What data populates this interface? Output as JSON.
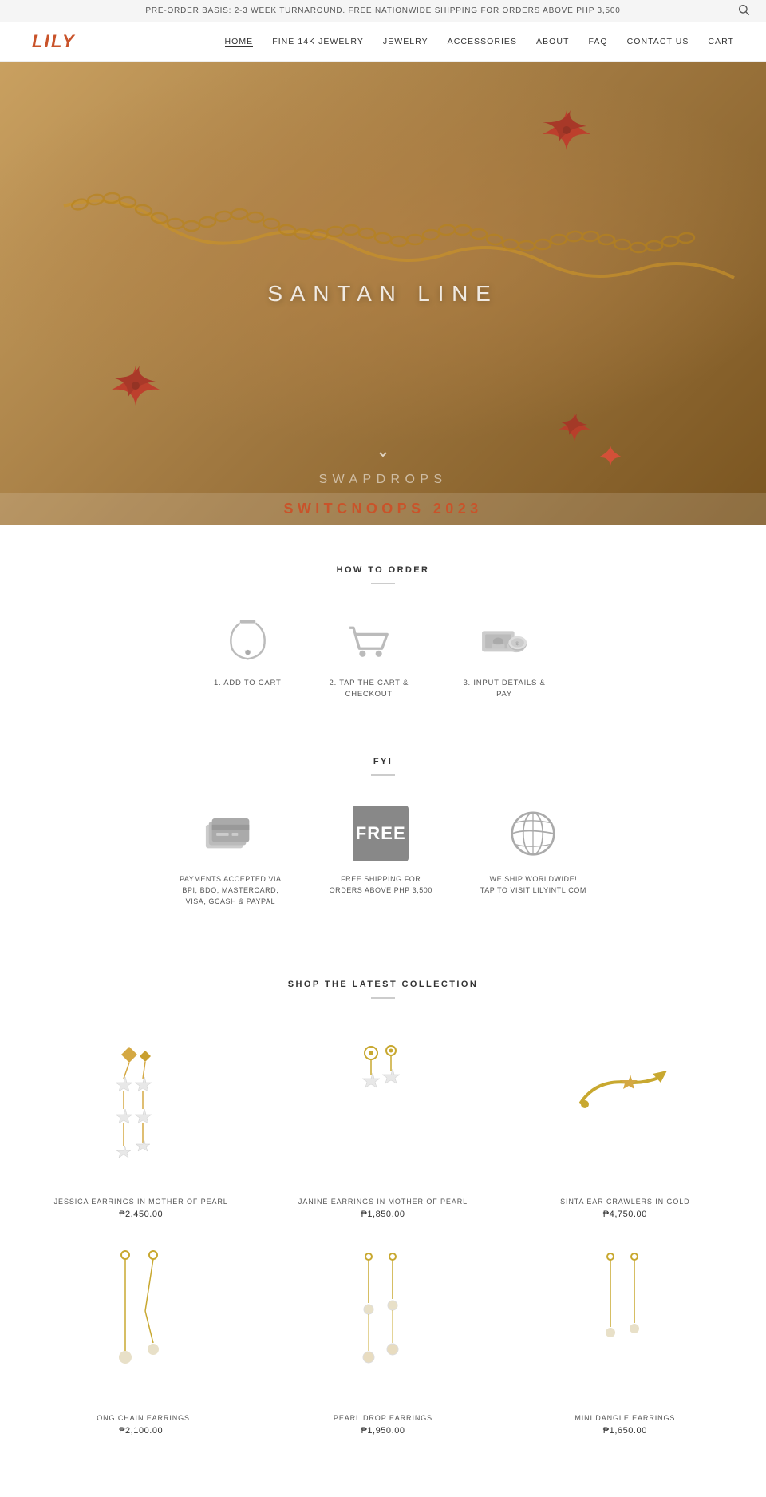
{
  "announcement": {
    "text": "PRE-ORDER BASIS: 2-3 WEEK TURNAROUND. FREE NATIONWIDE SHIPPING FOR ORDERS ABOVE PHP 3,500",
    "search_icon": "search-icon"
  },
  "header": {
    "logo": "LILY",
    "nav_items": [
      {
        "label": "HOME",
        "active": true,
        "key": "home"
      },
      {
        "label": "FINE 14K JEWELRY",
        "active": false,
        "key": "fine-14k"
      },
      {
        "label": "JEWELRY",
        "active": false,
        "key": "jewelry"
      },
      {
        "label": "ACCESSORIES",
        "active": false,
        "key": "accessories"
      },
      {
        "label": "ABOUT",
        "active": false,
        "key": "about"
      },
      {
        "label": "FAQ",
        "active": false,
        "key": "faq"
      },
      {
        "label": "CONTACT US",
        "active": false,
        "key": "contact"
      },
      {
        "label": "CART",
        "active": false,
        "key": "cart"
      }
    ]
  },
  "hero": {
    "title": "SANTAN LINE",
    "swapdrops": "SWAPDROPS",
    "switchoops": "SWITCNOOPS 2023"
  },
  "how_to_order": {
    "section_title": "HOW TO ORDER",
    "steps": [
      {
        "number": "1.",
        "label": "ADD TO CART",
        "icon": "necklace-icon"
      },
      {
        "number": "2.",
        "label": "TAP THE CART &\nCHECKOUT",
        "icon": "cart-icon"
      },
      {
        "number": "3.",
        "label": "INPUT DETAILS & PAY",
        "icon": "payment-icon"
      }
    ]
  },
  "fyi": {
    "section_title": "FYI",
    "items": [
      {
        "label": "PAYMENTS ACCEPTED VIA\nBPI, BDO, MASTERCARD,\nVISA, GCASH & PAYPAL",
        "icon": "credit-card-icon"
      },
      {
        "label": "FREE SHIPPING FOR\nORDERS ABOVE PHP 3,500",
        "icon": "free-shipping-icon"
      },
      {
        "label": "WE SHIP WORLDWIDE!\nTAP TO VISIT LILYINTL.COM",
        "icon": "globe-icon"
      }
    ]
  },
  "shop": {
    "section_title": "SHOP THE LATEST COLLECTION",
    "products": [
      {
        "name": "JESSICA EARRINGS IN MOTHER OF PEARL",
        "price": "₱2,450.00",
        "key": "jessica-earrings"
      },
      {
        "name": "JANINE EARRINGS IN MOTHER OF PEARL",
        "price": "₱1,850.00",
        "key": "janine-earrings"
      },
      {
        "name": "SINTA EAR CRAWLERS IN GOLD",
        "price": "₱4,750.00",
        "key": "sinta-crawlers"
      },
      {
        "name": "LONG CHAIN EARRINGS",
        "price": "₱2,100.00",
        "key": "long-chain-earrings"
      },
      {
        "name": "PEARL DROP EARRINGS",
        "price": "₱1,950.00",
        "key": "pearl-drop-earrings"
      },
      {
        "name": "MINI DANGLE EARRINGS",
        "price": "₱1,650.00",
        "key": "mini-dangle-earrings"
      }
    ]
  },
  "colors": {
    "accent": "#c9532a",
    "logo": "#c9532a",
    "nav_text": "#333333",
    "icon_gray": "#aaaaaa"
  }
}
